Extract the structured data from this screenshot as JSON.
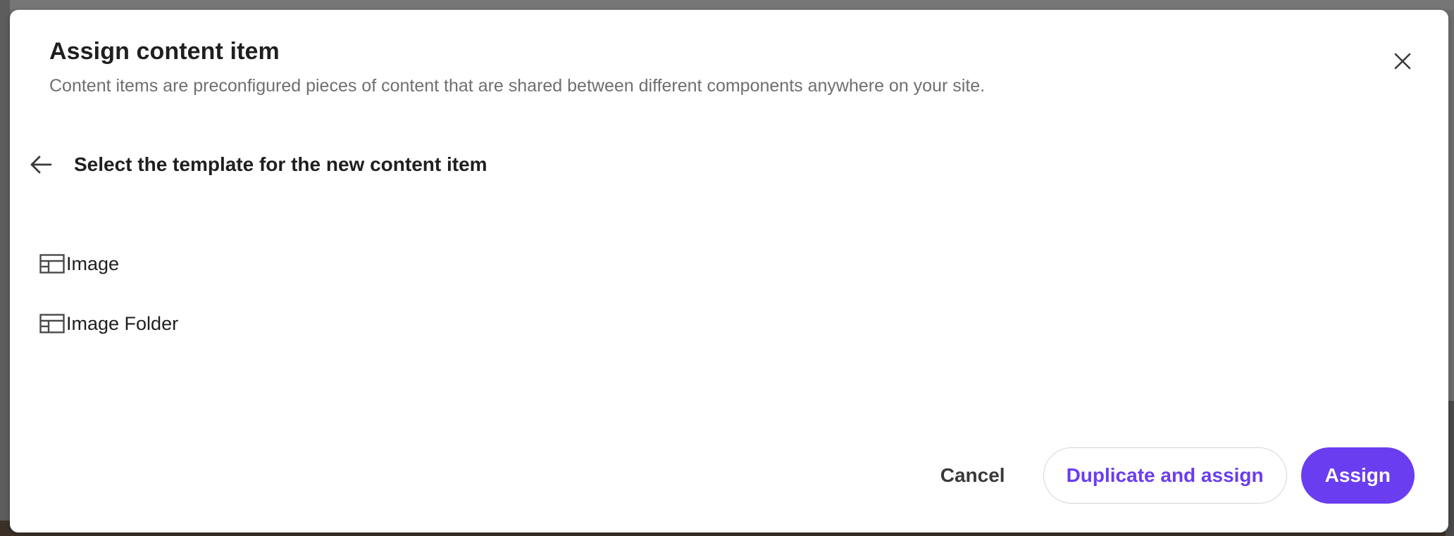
{
  "modal": {
    "title": "Assign content item",
    "subtitle": "Content items are preconfigured pieces of content that are shared between different components anywhere on your site.",
    "close_icon": "close-icon"
  },
  "step": {
    "back_icon": "arrow-left-icon",
    "title": "Select the template for the new content item"
  },
  "templates": [
    {
      "label": "Image",
      "icon": "layout-template-icon"
    },
    {
      "label": "Image Folder",
      "icon": "layout-template-icon"
    }
  ],
  "footer": {
    "cancel_label": "Cancel",
    "duplicate_label": "Duplicate and assign",
    "assign_label": "Assign"
  },
  "colors": {
    "accent": "#6a3df0",
    "text_primary": "#1f1f1f",
    "text_secondary": "#6f6f6f"
  }
}
